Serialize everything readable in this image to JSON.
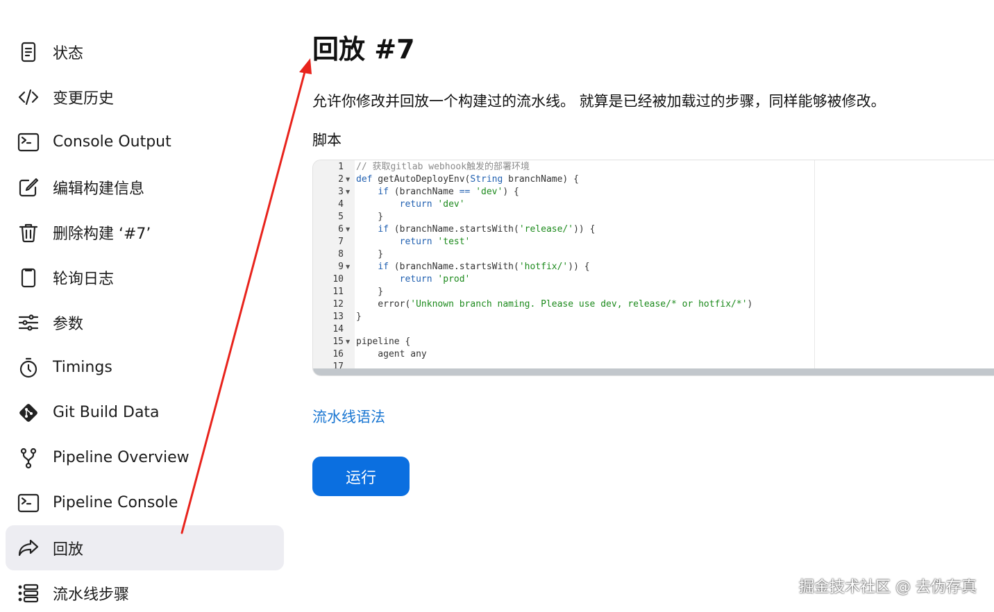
{
  "sidebar": {
    "items": [
      {
        "label": "状态",
        "icon": "document-icon"
      },
      {
        "label": "变更历史",
        "icon": "code-icon"
      },
      {
        "label": "Console Output",
        "icon": "terminal-icon"
      },
      {
        "label": "编辑构建信息",
        "icon": "edit-icon"
      },
      {
        "label": "删除构建 ‘#7’",
        "icon": "trash-icon"
      },
      {
        "label": "轮询日志",
        "icon": "clipboard-icon"
      },
      {
        "label": "参数",
        "icon": "sliders-icon"
      },
      {
        "label": "Timings",
        "icon": "stopwatch-icon"
      },
      {
        "label": "Git Build Data",
        "icon": "git-icon"
      },
      {
        "label": "Pipeline Overview",
        "icon": "branch-icon"
      },
      {
        "label": "Pipeline Console",
        "icon": "terminal-icon"
      },
      {
        "label": "回放",
        "icon": "share-icon",
        "active": true
      },
      {
        "label": "流水线步骤",
        "icon": "list-icon"
      }
    ]
  },
  "main": {
    "title": "回放 #7",
    "description": "允许你修改并回放一个构建过的流水线。 就算是已经被加载过的步骤，同样能够被修改。",
    "script_label": "脚本",
    "syntax_link": "流水线语法",
    "run_button": "运行"
  },
  "editor": {
    "lines": [
      {
        "n": "1",
        "fold": false,
        "tokens": [
          [
            "comment",
            "// 获取gitlab webhook触发的部署环境"
          ]
        ]
      },
      {
        "n": "2",
        "fold": true,
        "tokens": [
          [
            "kw",
            "def"
          ],
          [
            "plain",
            " getAutoDeployEnv("
          ],
          [
            "kw",
            "String"
          ],
          [
            "plain",
            " branchName) {"
          ]
        ]
      },
      {
        "n": "3",
        "fold": true,
        "tokens": [
          [
            "plain",
            "    "
          ],
          [
            "kw",
            "if"
          ],
          [
            "plain",
            " (branchName "
          ],
          [
            "kw",
            "=="
          ],
          [
            "plain",
            " "
          ],
          [
            "str",
            "'dev'"
          ],
          [
            "plain",
            ") {"
          ]
        ]
      },
      {
        "n": "4",
        "fold": false,
        "tokens": [
          [
            "plain",
            "        "
          ],
          [
            "kw",
            "return"
          ],
          [
            "plain",
            " "
          ],
          [
            "str",
            "'dev'"
          ]
        ]
      },
      {
        "n": "5",
        "fold": false,
        "tokens": [
          [
            "plain",
            "    }"
          ]
        ]
      },
      {
        "n": "6",
        "fold": true,
        "tokens": [
          [
            "plain",
            "    "
          ],
          [
            "kw",
            "if"
          ],
          [
            "plain",
            " (branchName.startsWith("
          ],
          [
            "str",
            "'release/'"
          ],
          [
            "plain",
            ")) {"
          ]
        ]
      },
      {
        "n": "7",
        "fold": false,
        "tokens": [
          [
            "plain",
            "        "
          ],
          [
            "kw",
            "return"
          ],
          [
            "plain",
            " "
          ],
          [
            "str",
            "'test'"
          ]
        ]
      },
      {
        "n": "8",
        "fold": false,
        "tokens": [
          [
            "plain",
            "    }"
          ]
        ]
      },
      {
        "n": "9",
        "fold": true,
        "tokens": [
          [
            "plain",
            "    "
          ],
          [
            "kw",
            "if"
          ],
          [
            "plain",
            " (branchName.startsWith("
          ],
          [
            "str",
            "'hotfix/'"
          ],
          [
            "plain",
            ")) {"
          ]
        ]
      },
      {
        "n": "10",
        "fold": false,
        "tokens": [
          [
            "plain",
            "        "
          ],
          [
            "kw",
            "return"
          ],
          [
            "plain",
            " "
          ],
          [
            "str",
            "'prod'"
          ]
        ]
      },
      {
        "n": "11",
        "fold": false,
        "tokens": [
          [
            "plain",
            "    }"
          ]
        ]
      },
      {
        "n": "12",
        "fold": false,
        "tokens": [
          [
            "plain",
            "    error("
          ],
          [
            "str",
            "'Unknown branch naming. Please use dev, release/* or hotfix/*'"
          ],
          [
            "plain",
            ")"
          ]
        ]
      },
      {
        "n": "13",
        "fold": false,
        "tokens": [
          [
            "plain",
            "}"
          ]
        ]
      },
      {
        "n": "14",
        "fold": false,
        "tokens": [
          [
            "plain",
            ""
          ]
        ]
      },
      {
        "n": "15",
        "fold": true,
        "tokens": [
          [
            "plain",
            "pipeline {"
          ]
        ]
      },
      {
        "n": "16",
        "fold": false,
        "tokens": [
          [
            "plain",
            "    agent any"
          ]
        ]
      },
      {
        "n": "17",
        "fold": false,
        "tokens": [
          [
            "plain",
            ""
          ]
        ]
      }
    ]
  },
  "watermark": "掘金技术社区 @ 去伪存真",
  "colors": {
    "accent": "#0b6fe0",
    "link": "#1976d2",
    "annotation_arrow": "#e8231c",
    "active_bg": "#ededf2"
  }
}
